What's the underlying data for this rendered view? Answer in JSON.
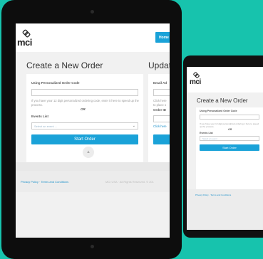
{
  "app": {
    "logo_text": "mci",
    "home_label": "Home"
  },
  "order": {
    "title": "Create a New Order",
    "code_label": "Using Personalized Order Code",
    "code_value": "",
    "help_text": "If you have your 12 digit personalized ordering code, enter it here to speed up the process.",
    "phone_help_text": "If you have your 12 digit personalized ordering c here to speed up the process.",
    "or_text": "OR",
    "events_label": "Events List",
    "event_placeholder": "Select an event ...",
    "start_button": "Start Order"
  },
  "update": {
    "title": "Updat",
    "email_label": "Email Ad",
    "help_line1": "Click here",
    "help_line2": "to place o",
    "order_label": "Order ID",
    "click_here": "Click here"
  },
  "footer": {
    "links_text": "Privacy Policy · Terms and Conditions",
    "copyright": "MCI USA · All Rights Reserved. © 201",
    "phone_links_text": "Privacy Policy · Terms and Conditions"
  },
  "colors": {
    "background": "#17c3ad",
    "accent": "#1aa2d8",
    "link": "#1a8fc9"
  },
  "icons": {
    "logo": "mci-knot-logo",
    "scroll_top": "chevron-up-icon",
    "select": "chevron-down-icon"
  }
}
